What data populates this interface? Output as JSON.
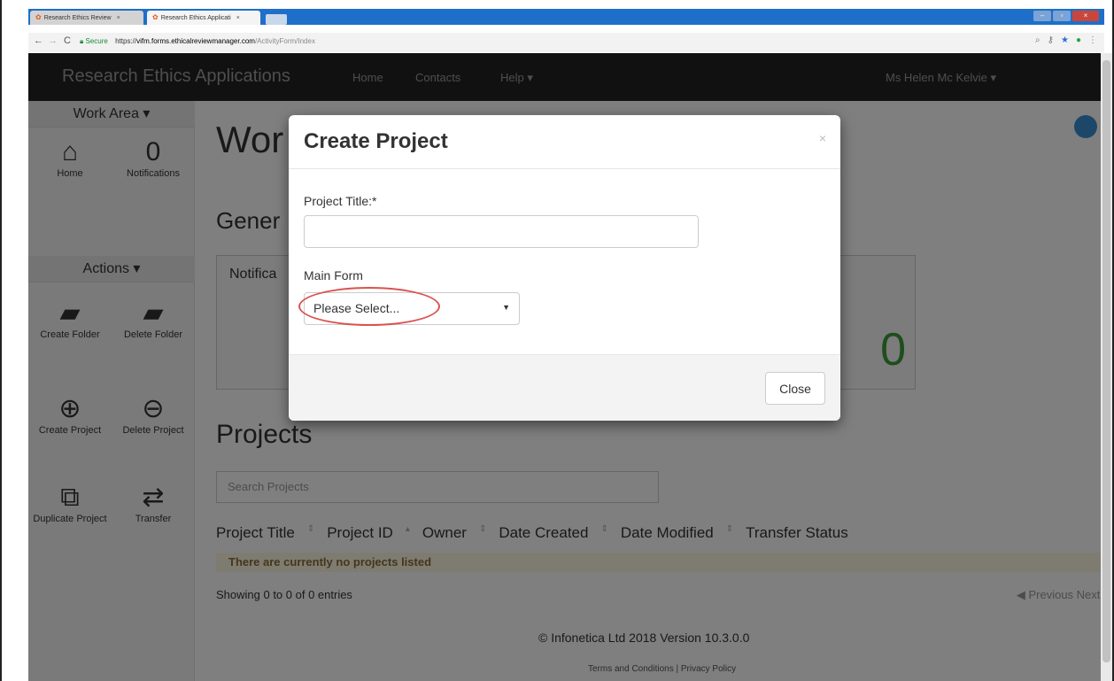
{
  "browser": {
    "tabs": [
      {
        "label": "Research Ethics Review",
        "active": false
      },
      {
        "label": "Research Ethics Applicati",
        "active": true
      }
    ],
    "url": {
      "secure_label": "Secure",
      "prefix": "https://",
      "host": "vifm.forms.ethicalreviewmanager.com",
      "path": "/ActivityForm/Index"
    }
  },
  "navbar": {
    "brand": "Research Ethics Applications",
    "items": [
      "Home",
      "Contacts",
      "Help ▾"
    ],
    "user": "Ms Helen Mc Kelvie ▾"
  },
  "sidebar": {
    "work_area": "Work Area ▾",
    "home_label": "Home",
    "notifications_count": "0",
    "notifications_label": "Notifications",
    "actions": "Actions ▾",
    "create_folder": "Create Folder",
    "delete_folder": "Delete Folder",
    "create_project": "Create Project",
    "delete_project": "Delete Project",
    "duplicate_project": "Duplicate Project",
    "transfer": "Transfer"
  },
  "main": {
    "workspace_title": "Wor",
    "general_title": "Gener",
    "notifications_label": "Notifica",
    "notifications_count": "0",
    "projects_title": "Projects",
    "search_placeholder": "Search Projects",
    "columns": [
      "Project Title",
      "Project ID",
      "Owner",
      "Date Created",
      "Date Modified",
      "Transfer Status"
    ],
    "empty_message": "There are currently no projects listed",
    "showing": "Showing 0 to 0 of 0 entries",
    "pager": "◀ Previous  Next ▶",
    "footer": "© Infonetica Ltd 2018 Version 10.3.0.0",
    "footer_links": "Terms and Conditions | Privacy Policy"
  },
  "modal": {
    "title": "Create Project",
    "close_x": "×",
    "project_title_label": "Project Title:*",
    "project_title_value": "",
    "main_form_label": "Main Form",
    "main_form_value": "Please Select...",
    "close_button": "Close"
  },
  "colors": {
    "navbar_bg": "#222222",
    "notification_count": "#3c9a3c",
    "empty_row_bg": "#fcf8e3",
    "highlight": "#d9534f"
  }
}
